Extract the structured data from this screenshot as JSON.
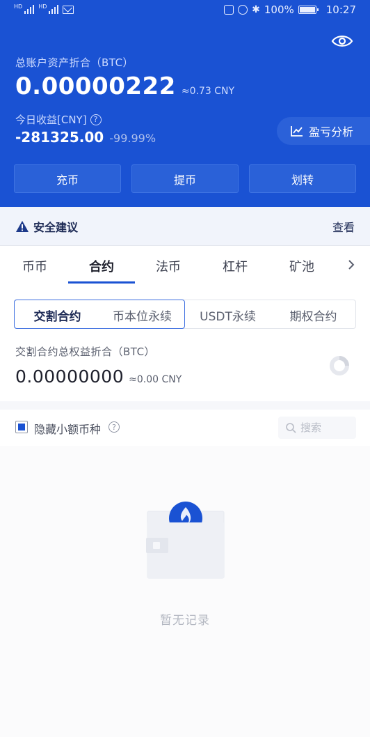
{
  "status_bar": {
    "battery": "100%",
    "time": "10:27",
    "battery_level": 1.0
  },
  "header": {
    "total_label": "总账户资产折合（BTC）",
    "total_value": "0.00000222",
    "total_cny": "≈0.73 CNY",
    "income_label": "今日收益[CNY]",
    "income_help": "?",
    "income_value": "-281325.00",
    "income_pct": "-99.99%",
    "pl_button": "盈亏分析",
    "actions": [
      "充币",
      "提币",
      "划转"
    ]
  },
  "security": {
    "title": "安全建议",
    "link": "查看"
  },
  "tabs": {
    "items": [
      "币币",
      "合约",
      "法币",
      "杠杆",
      "矿池"
    ],
    "active": "合约"
  },
  "segment": {
    "items": [
      "交割合约",
      "币本位永续",
      "USDT永续",
      "期权合约"
    ],
    "active": "交割合约"
  },
  "contract": {
    "label": "交割合约总权益折合（BTC）",
    "value": "0.00000000",
    "cny": "≈0.00 CNY"
  },
  "filter": {
    "hide_small": "隐藏小额币种",
    "hide_small_checked": true,
    "help": "?",
    "search_placeholder": "搜索"
  },
  "empty": {
    "text": "暂无记录"
  },
  "colors": {
    "brand": "#1a52d3",
    "header_bg": "#1a52d3",
    "negative_text": "#ffffff",
    "muted": "#b3b7c1"
  }
}
